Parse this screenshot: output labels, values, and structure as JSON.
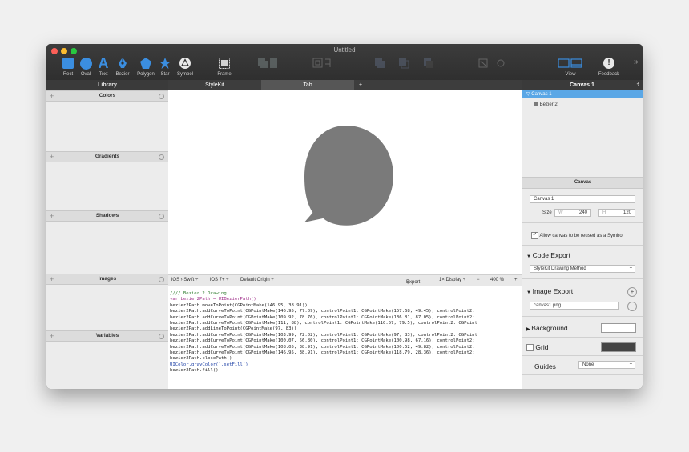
{
  "window": {
    "title": "Untitled"
  },
  "toolbar": {
    "tools": [
      {
        "label": "Rect",
        "icon": "rectangle-icon"
      },
      {
        "label": "Oval",
        "icon": "oval-icon"
      },
      {
        "label": "Text",
        "icon": "text-icon"
      },
      {
        "label": "Bezier",
        "icon": "bezier-pen-icon"
      },
      {
        "label": "Polygon",
        "icon": "polygon-icon"
      },
      {
        "label": "Star",
        "icon": "star-icon"
      },
      {
        "label": "Symbol",
        "icon": "symbol-icon"
      },
      {
        "label": "Frame",
        "icon": "frame-icon"
      }
    ],
    "view_label": "View",
    "feedback_label": "Feedback",
    "overflow": "»"
  },
  "library": {
    "title": "Library",
    "sections": [
      "Colors",
      "Gradients",
      "Shadows",
      "Images",
      "Variables"
    ]
  },
  "tabs": {
    "stylekit": "StyleKit",
    "tab": "Tab",
    "add": "+"
  },
  "codebar": {
    "language": "iOS › Swift ÷",
    "version": "iOS 7+ ÷",
    "origin": "Default Origin ÷",
    "export": "Export",
    "display": "1× Display ÷",
    "minus": "−",
    "zoom": "400 %",
    "plus": "+"
  },
  "code_lines": [
    "//// Bezier 2 Drawing",
    "var bezier2Path = UIBezierPath()",
    "bezier2Path.moveToPoint(CGPointMake(146.95, 38.91))",
    "bezier2Path.addCurveToPoint(CGPointMake(146.95, 77.09), controlPoint1: CGPointMake(157.68, 49.45), controlPoint2:",
    "bezier2Path.addCurveToPoint(CGPointMake(109.92, 78.76), controlPoint1: CGPointMake(136.81, 87.05), controlPoint2:",
    "bezier2Path.addCurveToPoint(CGPointMake(111, 88), controlPoint1: CGPointMake(110.57, 79.5), controlPoint2: CGPoint",
    "bezier2Path.addLineToPoint(CGPointMake(97, 83))",
    "bezier2Path.addCurveToPoint(CGPointMake(103.99, 72.02), controlPoint1: CGPointMake(97, 83), controlPoint2: CGPoint",
    "bezier2Path.addCurveToPoint(CGPointMake(100.07, 56.80), controlPoint1: CGPointMake(100.98, 67.16), controlPoint2:",
    "bezier2Path.addCurveToPoint(CGPointMake(108.05, 38.91), controlPoint1: CGPointMake(100.52, 49.82), controlPoint2:",
    "bezier2Path.addCurveToPoint(CGPointMake(146.95, 38.91), controlPoint1: CGPointMake(118.79, 28.36), controlPoint2:",
    "bezier2Path.closePath()",
    "UIColor.grayColor().setFill()",
    "bezier2Path.fill()"
  ],
  "inspector": {
    "title": "Canvas 1",
    "tree": {
      "canvas": "Canvas 1",
      "shape": "Bezier 2"
    },
    "canvas_section": "Canvas",
    "name_value": "Canvas 1",
    "size_label": "Size",
    "w_label": "W",
    "w_value": "240",
    "h_label": "H",
    "h_value": "120",
    "reuse_label": "Allow canvas to be reused as a Symbol",
    "code_export": "Code Export",
    "code_export_value": "StyleKit Drawing Method",
    "image_export": "Image Export",
    "image_file": "canvas1.png",
    "background": "Background",
    "grid": "Grid",
    "guides": "Guides",
    "guides_value": "None"
  },
  "colors": {
    "accent": "#3b8ee0",
    "selection": "#5aa7e6",
    "shape_fill": "#7a7a7a"
  }
}
